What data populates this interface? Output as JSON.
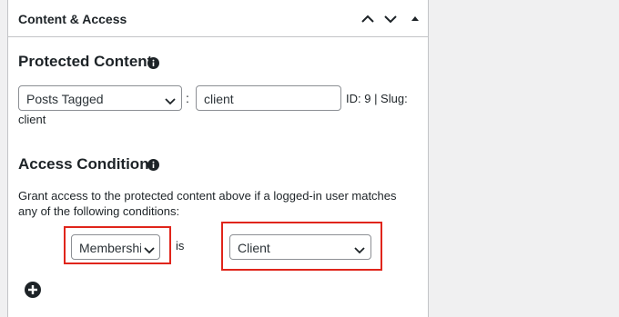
{
  "panel": {
    "title": "Content & Access",
    "controls": {
      "move_up_icon": "chevron-up-icon",
      "move_down_icon": "chevron-down-icon",
      "toggle_icon": "triangle-up-icon"
    }
  },
  "protected_content": {
    "heading": "Protected Content",
    "type_select": {
      "value": "Posts Tagged"
    },
    "separator": ":",
    "tag_input": {
      "value": "client"
    },
    "meta_line1": "ID: 9 | Slug:",
    "meta_line2": "client"
  },
  "access_conditions": {
    "heading": "Access Conditions",
    "help_text": "Grant access to the protected content above if a logged-in user matches any of the following conditions:",
    "rule": {
      "field_select": {
        "value": "Membership"
      },
      "operator": "is",
      "value_select": {
        "value": "Client"
      }
    },
    "add_icon": "plus-circle-icon"
  },
  "colors": {
    "highlight": "#e0251b",
    "border": "#c3c4c7"
  }
}
